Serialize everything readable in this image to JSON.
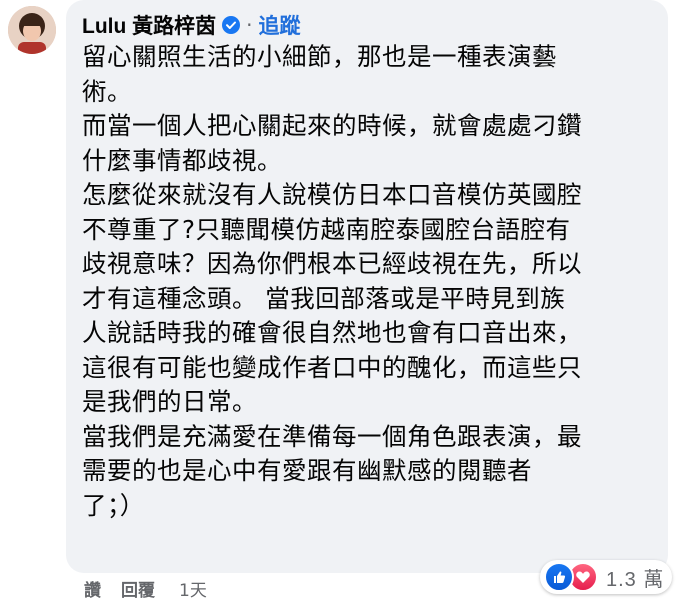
{
  "author": {
    "name": "Lulu 黃路梓茵",
    "verified": true,
    "separator": "·",
    "follow_label": "追蹤"
  },
  "comment": {
    "lines": [
      "留心關照生活的小細節，那也是一種表演藝",
      "術。",
      "而當一個人把心關起來的時候，就會處處刁鑽",
      "什麼事情都歧視。",
      "怎麼從來就沒有人說模仿日本口音模仿英國腔",
      "不尊重了?只聽聞模仿越南腔泰國腔台語腔有",
      "歧視意味？因為你們根本已經歧視在先，所以",
      "才有這種念頭。 當我回部落或是平時見到族",
      "人說話時我的確會很自然地也會有口音出來，",
      "這很有可能也變成作者口中的醜化，而這些只",
      "是我們的日常。",
      "當我們是充滿愛在準備每一個角色跟表演，最",
      "需要的也是心中有愛跟有幽默感的閱聽者",
      "了；）"
    ]
  },
  "reactions": {
    "icons": [
      "like-icon",
      "love-icon"
    ],
    "count": "1.3 萬"
  },
  "actions": {
    "like_label": "讚",
    "reply_label": "回覆",
    "timestamp": "1天"
  },
  "colors": {
    "bubble": "#f0f2f5",
    "follow": "#216fdb",
    "meta": "#65676b",
    "like": "#1877f2",
    "love": "#f33e58"
  }
}
